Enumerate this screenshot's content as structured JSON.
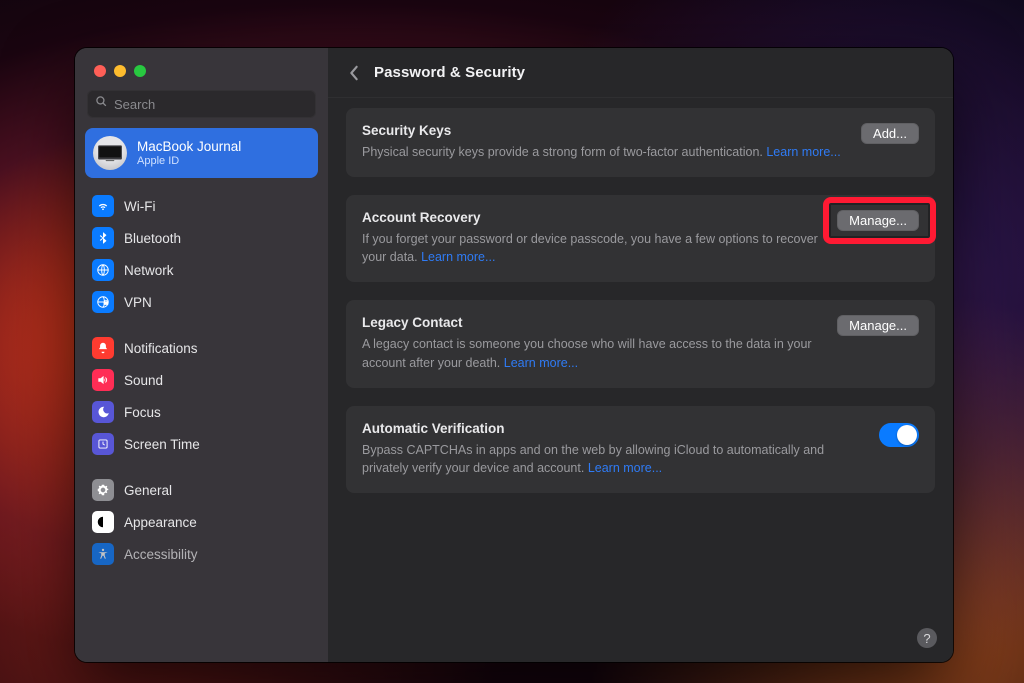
{
  "header": {
    "title": "Password & Security"
  },
  "search": {
    "placeholder": "Search"
  },
  "account": {
    "name": "MacBook Journal",
    "subtitle": "Apple ID"
  },
  "sidebar": {
    "groups": [
      {
        "items": [
          {
            "id": "wifi",
            "label": "Wi-Fi"
          },
          {
            "id": "bluetooth",
            "label": "Bluetooth"
          },
          {
            "id": "network",
            "label": "Network"
          },
          {
            "id": "vpn",
            "label": "VPN"
          }
        ]
      },
      {
        "items": [
          {
            "id": "notifications",
            "label": "Notifications"
          },
          {
            "id": "sound",
            "label": "Sound"
          },
          {
            "id": "focus",
            "label": "Focus"
          },
          {
            "id": "screentime",
            "label": "Screen Time"
          }
        ]
      },
      {
        "items": [
          {
            "id": "general",
            "label": "General"
          },
          {
            "id": "appearance",
            "label": "Appearance"
          },
          {
            "id": "accessibility",
            "label": "Accessibility"
          }
        ]
      }
    ]
  },
  "sections": {
    "securityKeys": {
      "title": "Security Keys",
      "desc": "Physical security keys provide a strong form of two-factor authentication. ",
      "learnMore": "Learn more...",
      "button": "Add..."
    },
    "accountRecovery": {
      "title": "Account Recovery",
      "desc": "If you forget your password or device passcode, you have a few options to recover your data. ",
      "learnMore": "Learn more...",
      "button": "Manage..."
    },
    "legacyContact": {
      "title": "Legacy Contact",
      "desc": "A legacy contact is someone you choose who will have access to the data in your account after your death. ",
      "learnMore": "Learn more...",
      "button": "Manage..."
    },
    "automaticVerification": {
      "title": "Automatic Verification",
      "desc": "Bypass CAPTCHAs in apps and on the web by allowing iCloud to automatically and privately verify your device and account. ",
      "learnMore": "Learn more...",
      "toggle": true
    }
  },
  "help": {
    "label": "?"
  },
  "colors": {
    "accent": "#0a7bff",
    "highlight": "#ff1a33"
  }
}
